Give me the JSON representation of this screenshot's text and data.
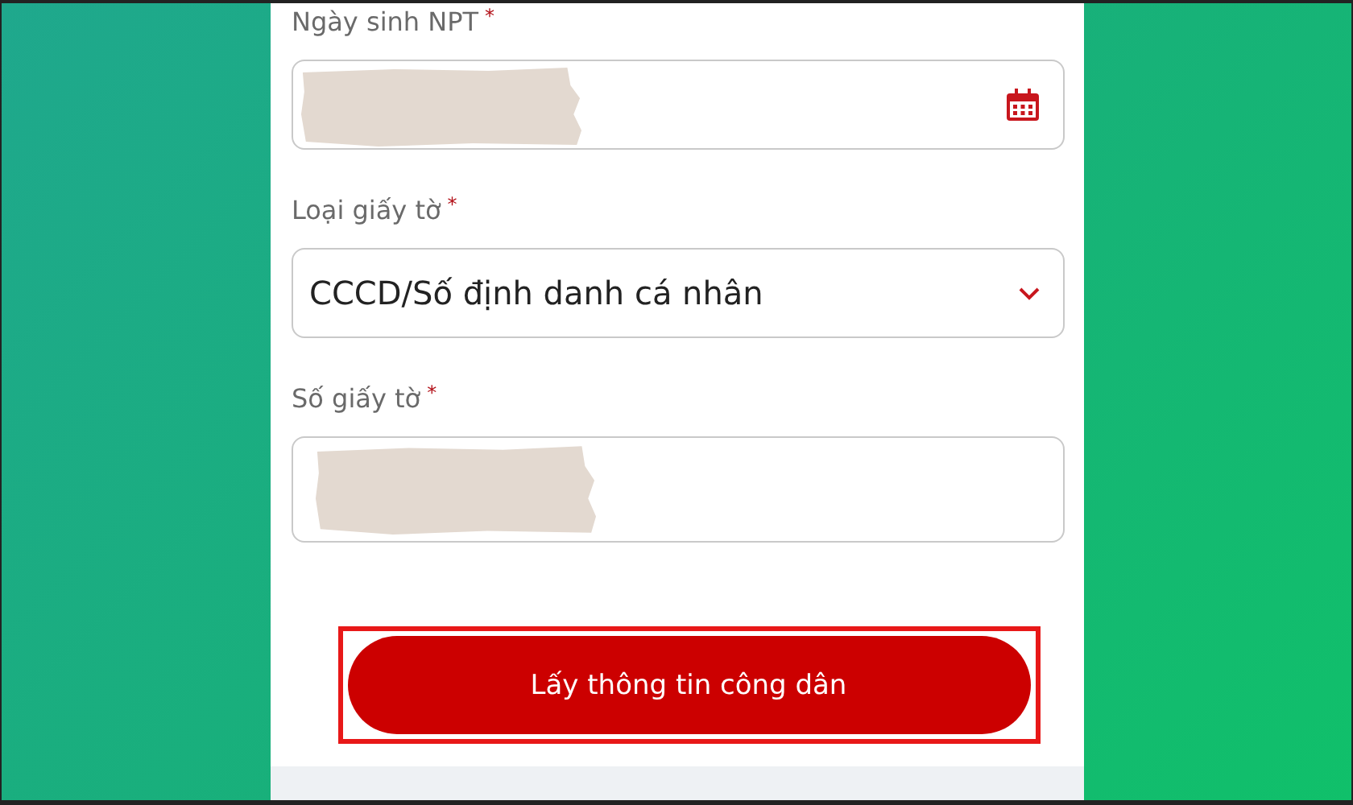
{
  "fields": [
    {
      "label": "Ngày sinh NPT",
      "required_mark": "*",
      "kind": "date",
      "redacted": true
    },
    {
      "label": "Loại giấy tờ",
      "required_mark": "*",
      "kind": "select",
      "value": "CCCD/Số định danh cá nhân"
    },
    {
      "label": "Số giấy tờ",
      "required_mark": "*",
      "kind": "text",
      "redacted": true
    }
  ],
  "submit_button": {
    "label": "Lấy thông tin công dân",
    "highlighted": true
  }
}
